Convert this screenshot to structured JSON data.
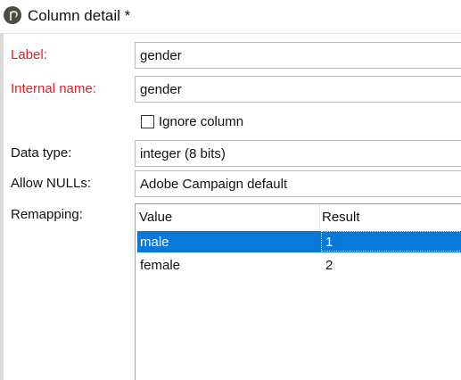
{
  "window": {
    "title": "Column detail *"
  },
  "form": {
    "label": {
      "label": "Label:",
      "value": "gender"
    },
    "internal_name": {
      "label": "Internal name:",
      "value": "gender"
    },
    "ignore_column": {
      "label": "Ignore column",
      "checked": false
    },
    "data_type": {
      "label": "Data type:",
      "value": "integer (8 bits)"
    },
    "allow_nulls": {
      "label": "Allow NULLs:",
      "value": "Adobe Campaign default"
    },
    "remapping": {
      "label": "Remapping:",
      "columns": [
        "Value",
        "Result"
      ],
      "rows": [
        {
          "value": "male",
          "result": "1",
          "selected": true
        },
        {
          "value": "female",
          "result": "2",
          "selected": false
        }
      ]
    }
  },
  "colors": {
    "required_label": "#e0202a",
    "selection": "#0a78d7"
  }
}
